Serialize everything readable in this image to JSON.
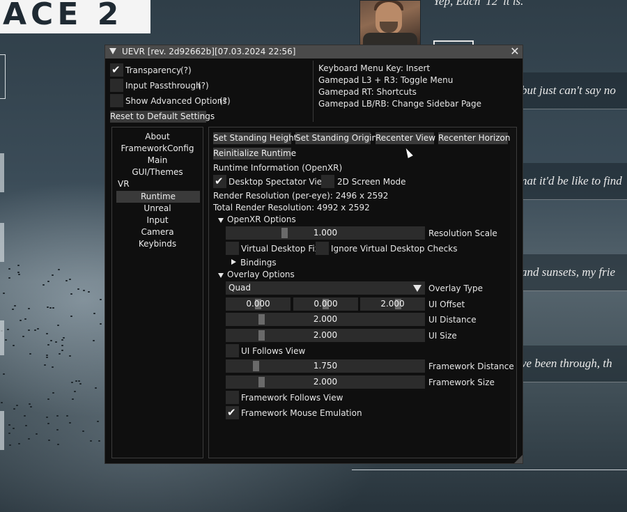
{
  "background": {
    "logo_text": "ACE 2",
    "top_quote": "Yep, Each '12' it is.",
    "dialog_lines": [
      "but just can't say no",
      "nat it'd be like to find",
      "and sunsets, my frie",
      "ve been through, th"
    ]
  },
  "window": {
    "title": "UEVR [rev. 2d92662b][07.03.2024 22:56]",
    "close_glyph": "✕"
  },
  "top_options": {
    "transparency_label": "Transparency",
    "transparency_help": "(?)",
    "transparency_checked": true,
    "passthrough_label": "Input Passthrough",
    "passthrough_help": "(?)",
    "passthrough_checked": false,
    "advanced_label": "Show Advanced Options",
    "advanced_help": "(?)",
    "advanced_checked": false,
    "reset_label": "Reset to Default Settings"
  },
  "shortcuts": [
    "Keyboard Menu Key: Insert",
    "Gamepad L3 + R3: Toggle Menu",
    "Gamepad RT: Shortcuts",
    "Gamepad LB/RB: Change Sidebar Page"
  ],
  "sidebar": {
    "items": [
      {
        "label": "About"
      },
      {
        "label": "FrameworkConfig"
      },
      {
        "label": "Main"
      },
      {
        "label": "GUI/Themes"
      },
      {
        "label": "VR"
      },
      {
        "label": "Runtime",
        "selected": true
      },
      {
        "label": "Unreal"
      },
      {
        "label": "Input"
      },
      {
        "label": "Camera"
      },
      {
        "label": "Keybinds"
      }
    ]
  },
  "runtime": {
    "buttons": {
      "standing_height": "Set Standing Height",
      "standing_origin": "Set Standing Origin",
      "recenter_view": "Recenter View",
      "recenter_horizon": "Recenter Horizon",
      "reinitialize": "Reinitialize Runtime"
    },
    "info_header": "Runtime Information (OpenXR)",
    "desktop_spectator_label": "Desktop Spectator View",
    "desktop_spectator_checked": true,
    "screen_2d_label": "2D Screen Mode",
    "screen_2d_checked": false,
    "render_res": "Render Resolution (per-eye): 2496 x 2592",
    "total_res": "Total Render Resolution: 4992 x 2592",
    "openxr_header": "OpenXR Options",
    "resolution_scale_value": "1.000",
    "resolution_scale_label": "Resolution Scale",
    "resolution_scale_fraction": 0.29,
    "virtual_desktop_fix_label": "Virtual Desktop Fix",
    "ignore_vd_checks_label": "Ignore Virtual Desktop Checks",
    "bindings_label": "Bindings",
    "overlay_header": "Overlay Options",
    "overlay_type_value": "Quad",
    "overlay_type_label": "Overlay Type",
    "ui_offset_values": [
      "0.000",
      "0.000",
      "2.000"
    ],
    "ui_offset_label": "UI Offset",
    "ui_distance_value": "2.000",
    "ui_distance_label": "UI Distance",
    "ui_distance_fraction": 0.17,
    "ui_size_value": "2.000",
    "ui_size_label": "UI Size",
    "ui_size_fraction": 0.17,
    "ui_follows_view_label": "UI Follows View",
    "ui_follows_view_checked": false,
    "framework_distance_value": "1.750",
    "framework_distance_label": "Framework Distance",
    "framework_distance_fraction": 0.14,
    "framework_size_value": "2.000",
    "framework_size_label": "Framework Size",
    "framework_size_fraction": 0.17,
    "framework_follows_view_label": "Framework Follows View",
    "framework_follows_view_checked": false,
    "framework_mouse_label": "Framework Mouse Emulation",
    "framework_mouse_checked": true
  }
}
